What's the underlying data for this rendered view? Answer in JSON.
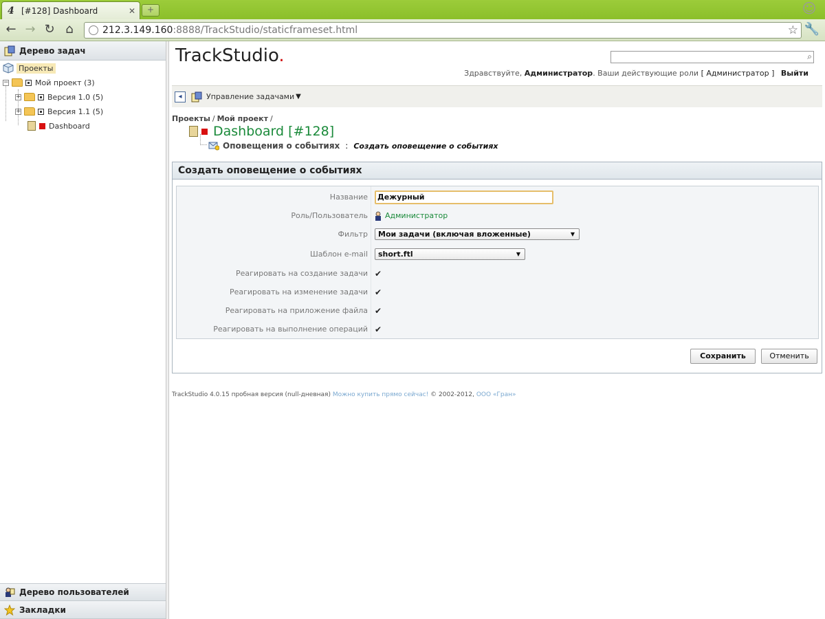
{
  "browser": {
    "tab_title": "[#128] Dashboard",
    "url_host": "212.3.149.160",
    "url_rest": ":8888/TrackStudio/staticframeset.html"
  },
  "left_panel": {
    "header": "Дерево задач",
    "tree": [
      {
        "label": "Проекты"
      },
      {
        "label": "Мой проект (3)"
      },
      {
        "label": "Версия 1.0 (5)"
      },
      {
        "label": "Версия 1.1 (5)"
      },
      {
        "label": "Dashboard"
      }
    ],
    "users_tree": "Дерево пользователей",
    "bookmarks": "Закладки"
  },
  "header": {
    "logo": "TrackStudio",
    "logo_dot": ".",
    "greeting_prefix": "Здравствуйте,",
    "user": "Администратор",
    "roles_text": ". Ваши действующие роли",
    "role_value": "[ Администратор ]",
    "logout": "Выйти"
  },
  "menu": {
    "task_management": "Управление задачами"
  },
  "breadcrumb": {
    "items": [
      "Проекты",
      "Мой проект"
    ],
    "separator": "/"
  },
  "task": {
    "title": "Dashboard  [#128]",
    "subsection": "Оповещения о событиях",
    "action": "Создать оповещение о событиях"
  },
  "form": {
    "title": "Создать оповещение о событиях",
    "fields": {
      "name_label": "Название",
      "name_value": "Дежурный",
      "role_label": "Роль/Пользователь",
      "role_value": "Администратор",
      "filter_label": "Фильтр",
      "filter_value": "Мои задачи (включая вложенные)",
      "template_label": "Шаблон e-mail",
      "template_value": "short.ftl",
      "react_create_label": "Реагировать на создание задачи",
      "react_update_label": "Реагировать на изменение задачи",
      "react_attach_label": "Реагировать на приложение файла",
      "react_ops_label": "Реагировать на выполнение операций"
    },
    "checkbox_glyph": "✔",
    "save": "Сохранить",
    "cancel": "Отменить"
  },
  "footer": {
    "text": "TrackStudio 4.0.15 пробная версия (null-дневная)",
    "buy_link": "Можно купить прямо сейчас!",
    "copyright": "© 2002-2012,",
    "company_link": "ООО «Гран»"
  },
  "colors": {
    "accent_green": "#1a8a3a",
    "logo_dot_red": "#d01010",
    "focus_border": "#e6be6a",
    "chrome_green": "#9ccc3a"
  },
  "icons": {
    "back": "back-arrow-icon",
    "forward": "forward-arrow-icon",
    "reload": "reload-icon",
    "home": "home-icon",
    "star": "bookmark-star-icon",
    "wrench": "wrench-icon",
    "search": "search-icon"
  }
}
